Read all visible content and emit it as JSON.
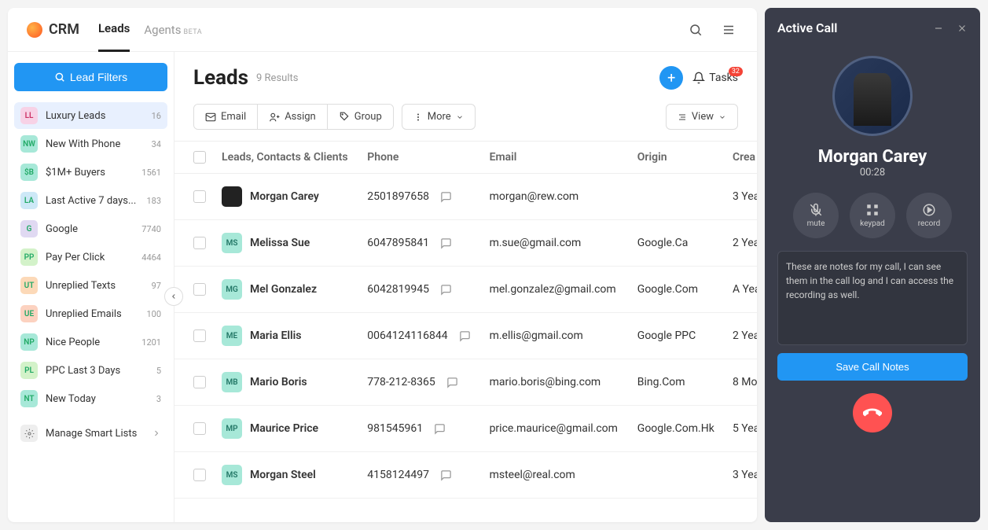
{
  "brand": "CRM",
  "nav": {
    "leads": "Leads",
    "agents": "Agents",
    "beta": "BETA"
  },
  "header": {
    "filters_btn": "Lead Filters",
    "title": "Leads",
    "results": "9 Results",
    "tasks_label": "Tasks",
    "tasks_count": "32"
  },
  "toolbar": {
    "email": "Email",
    "assign": "Assign",
    "group": "Group",
    "more": "More",
    "view": "View"
  },
  "sidebar": {
    "items": [
      {
        "abbr": "LL",
        "label": "Luxury Leads",
        "count": "16",
        "color": "#f7d2e6",
        "text": "#c36",
        "active": true
      },
      {
        "abbr": "NW",
        "label": "New With Phone",
        "count": "34",
        "color": "#a7e8d8"
      },
      {
        "abbr": "$B",
        "label": "$1M+ Buyers",
        "count": "1561",
        "color": "#a7e8d8"
      },
      {
        "abbr": "LA",
        "label": "Last Active 7 days...",
        "count": "183",
        "color": "#cde8f7"
      },
      {
        "abbr": "G",
        "label": "Google",
        "count": "7740",
        "color": "#e0d9f2"
      },
      {
        "abbr": "PP",
        "label": "Pay Per Click",
        "count": "4464",
        "color": "#d3f2c9"
      },
      {
        "abbr": "UT",
        "label": "Unreplied Texts",
        "count": "97",
        "color": "#fcd9b8"
      },
      {
        "abbr": "UE",
        "label": "Unreplied Emails",
        "count": "100",
        "color": "#fcd2c0"
      },
      {
        "abbr": "NP",
        "label": "Nice People",
        "count": "1201",
        "color": "#a7e8d8"
      },
      {
        "abbr": "PL",
        "label": "PPC Last 3 Days",
        "count": "5",
        "color": "#d3f2c9"
      },
      {
        "abbr": "NT",
        "label": "New Today",
        "count": "3",
        "color": "#a7e8d8"
      }
    ],
    "manage": "Manage Smart Lists"
  },
  "columns": {
    "c1": "Leads, Contacts & Clients",
    "c2": "Phone",
    "c3": "Email",
    "c4": "Origin",
    "c5": "Crea"
  },
  "rows": [
    {
      "abbr": "",
      "name": "Morgan Carey",
      "phone": "2501897658",
      "email": "morgan@rew.com",
      "origin": "",
      "created": "3 Yea",
      "img": true
    },
    {
      "abbr": "MS",
      "name": "Melissa Sue",
      "phone": "6047895841",
      "email": "m.sue@gmail.com",
      "origin": "Google.Ca",
      "created": "2 Yea"
    },
    {
      "abbr": "MG",
      "name": "Mel Gonzalez",
      "phone": "6042819945",
      "email": "mel.gonzalez@gmail.com",
      "origin": "Google.Com",
      "created": "A Yea"
    },
    {
      "abbr": "ME",
      "name": "Maria Ellis",
      "phone": "0064124116844",
      "email": "m.ellis@gmail.com",
      "origin": "Google PPC",
      "created": "2 Yea"
    },
    {
      "abbr": "MB",
      "name": "Mario Boris",
      "phone": "778-212-8365",
      "email": "mario.boris@bing.com",
      "origin": "Bing.Com",
      "created": "8 Mo"
    },
    {
      "abbr": "MP",
      "name": "Maurice Price",
      "phone": "981545961",
      "email": "price.maurice@gmail.com",
      "origin": "Google.Com.Hk",
      "created": "5 Yea"
    },
    {
      "abbr": "MS",
      "name": "Morgan Steel",
      "phone": "4158124497",
      "email": "msteel@real.com",
      "origin": "",
      "created": "3 Yea"
    }
  ],
  "call": {
    "title": "Active Call",
    "name": "Morgan Carey",
    "time": "00:28",
    "mute": "mute",
    "keypad": "keypad",
    "record": "record",
    "notes": "These are notes for my call, I can see them in the call log and I can access the recording as well.",
    "save": "Save Call Notes"
  }
}
